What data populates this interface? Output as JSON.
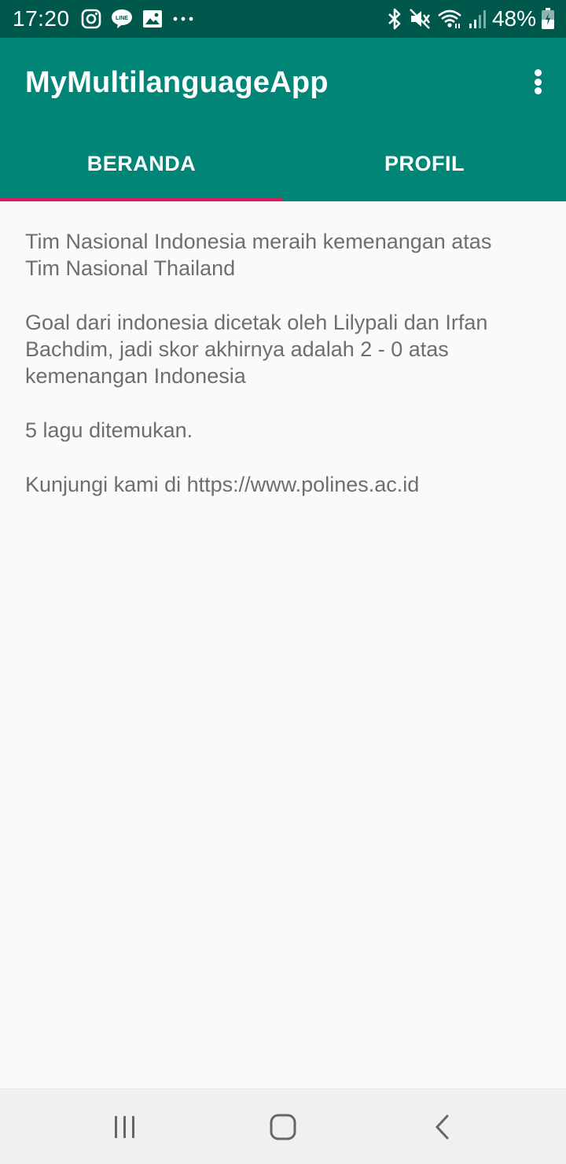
{
  "status_bar": {
    "time": "17:20",
    "battery": "48%",
    "left_icons": [
      "instagram-icon",
      "line-icon",
      "gallery-icon",
      "more-dots-icon"
    ],
    "right_icons": [
      "bluetooth-icon",
      "mute-icon",
      "wifi-icon",
      "signal-icon",
      "battery-icon"
    ]
  },
  "app_bar": {
    "title": "MyMultilanguageApp",
    "overflow_icon": "more-vert-icon"
  },
  "tabs": [
    {
      "label": "BERANDA",
      "selected": true
    },
    {
      "label": "PROFIL",
      "selected": false
    }
  ],
  "content": {
    "paragraphs": [
      "Tim Nasional Indonesia meraih kemenangan atas Tim Nasional Thailand",
      "Goal dari indonesia dicetak oleh Lilypali dan Irfan Bachdim, jadi skor akhirnya adalah 2 - 0 atas kemenangan Indonesia",
      "5 lagu ditemukan.",
      "Kunjungi kami di https://www.polines.ac.id"
    ]
  },
  "nav_bar": {
    "buttons": [
      "recents-icon",
      "home-icon",
      "back-icon"
    ]
  },
  "colors": {
    "status_bar": "#00574b",
    "primary": "#008577",
    "accent": "#d81b60",
    "background": "#fafafa",
    "text": "#6e6e6e"
  }
}
